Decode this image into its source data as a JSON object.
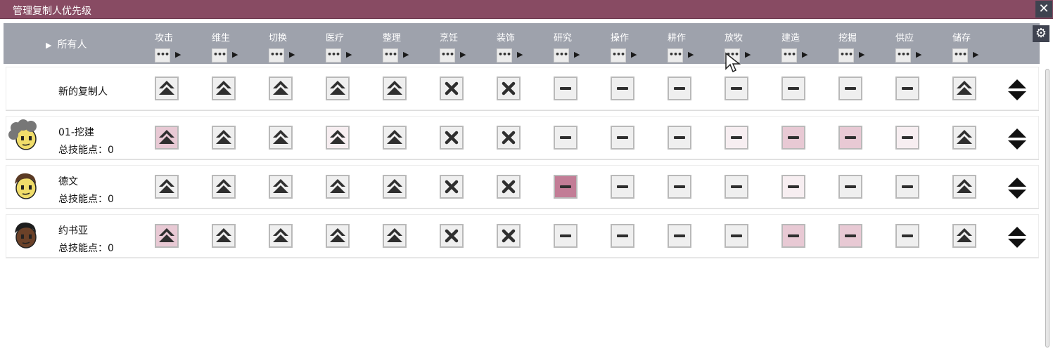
{
  "window": {
    "title": "管理复制人优先级",
    "close_glyph": "✕"
  },
  "header": {
    "owner_label": "所有人",
    "columns": [
      "攻击",
      "维生",
      "切换",
      "医疗",
      "整理",
      "烹饪",
      "装饰",
      "研究",
      "操作",
      "耕作",
      "放牧",
      "建造",
      "挖掘",
      "供应",
      "储存"
    ],
    "column_button_glyph": "•••"
  },
  "icons": {
    "collapse": "triangle-right-icon",
    "high": "double-chevron-up-icon",
    "disabled": "x-icon",
    "neutral": "minus-icon",
    "reorder": "up-down-arrows-icon",
    "settings": "gear-icon",
    "close": "close-icon"
  },
  "colors": {
    "titlebar": "#884b63",
    "header": "#9ea2ac",
    "tint_low": "#f7eef1",
    "tint_mid": "#e8c9d4",
    "tint_high": "#c27d96"
  },
  "rows": [
    {
      "name": "新的复制人",
      "skill_points": "",
      "avatar": "none",
      "cells": [
        {
          "icon": "up",
          "tint": 0
        },
        {
          "icon": "up",
          "tint": 0
        },
        {
          "icon": "up",
          "tint": 0
        },
        {
          "icon": "up",
          "tint": 0
        },
        {
          "icon": "up",
          "tint": 0
        },
        {
          "icon": "x",
          "tint": 0
        },
        {
          "icon": "x",
          "tint": 0
        },
        {
          "icon": "minus",
          "tint": 0
        },
        {
          "icon": "minus",
          "tint": 0
        },
        {
          "icon": "minus",
          "tint": 0
        },
        {
          "icon": "minus",
          "tint": 0
        },
        {
          "icon": "minus",
          "tint": 0
        },
        {
          "icon": "minus",
          "tint": 0
        },
        {
          "icon": "minus",
          "tint": 0
        },
        {
          "icon": "up",
          "tint": 0
        }
      ]
    },
    {
      "name": "01-挖建",
      "skill_points": "总技能点：0",
      "avatar": "gray-curly-hair",
      "cells": [
        {
          "icon": "up",
          "tint": 2
        },
        {
          "icon": "up",
          "tint": 0
        },
        {
          "icon": "up",
          "tint": 0
        },
        {
          "icon": "up",
          "tint": 1
        },
        {
          "icon": "up",
          "tint": 0
        },
        {
          "icon": "x",
          "tint": 0
        },
        {
          "icon": "x",
          "tint": 0
        },
        {
          "icon": "minus",
          "tint": 0
        },
        {
          "icon": "minus",
          "tint": 0
        },
        {
          "icon": "minus",
          "tint": 0
        },
        {
          "icon": "minus",
          "tint": 1
        },
        {
          "icon": "minus",
          "tint": 2
        },
        {
          "icon": "minus",
          "tint": 2
        },
        {
          "icon": "minus",
          "tint": 1
        },
        {
          "icon": "up",
          "tint": 0
        }
      ]
    },
    {
      "name": "德文",
      "skill_points": "总技能点：0",
      "avatar": "brown-hair",
      "cells": [
        {
          "icon": "up",
          "tint": 0
        },
        {
          "icon": "up",
          "tint": 0
        },
        {
          "icon": "up",
          "tint": 0
        },
        {
          "icon": "up",
          "tint": 0
        },
        {
          "icon": "up",
          "tint": 0
        },
        {
          "icon": "x",
          "tint": 0
        },
        {
          "icon": "x",
          "tint": 0
        },
        {
          "icon": "minus",
          "tint": 3
        },
        {
          "icon": "minus",
          "tint": 0
        },
        {
          "icon": "minus",
          "tint": 0
        },
        {
          "icon": "minus",
          "tint": 0
        },
        {
          "icon": "minus",
          "tint": 1
        },
        {
          "icon": "minus",
          "tint": 0
        },
        {
          "icon": "minus",
          "tint": 0
        },
        {
          "icon": "up",
          "tint": 0
        }
      ]
    },
    {
      "name": "约书亚",
      "skill_points": "总技能点：0",
      "avatar": "dark-skin-black-hair",
      "cells": [
        {
          "icon": "up",
          "tint": 2
        },
        {
          "icon": "up",
          "tint": 0
        },
        {
          "icon": "up",
          "tint": 0
        },
        {
          "icon": "up",
          "tint": 0
        },
        {
          "icon": "up",
          "tint": 0
        },
        {
          "icon": "x",
          "tint": 0
        },
        {
          "icon": "x",
          "tint": 0
        },
        {
          "icon": "minus",
          "tint": 0
        },
        {
          "icon": "minus",
          "tint": 0
        },
        {
          "icon": "minus",
          "tint": 0
        },
        {
          "icon": "minus",
          "tint": 0
        },
        {
          "icon": "minus",
          "tint": 2
        },
        {
          "icon": "minus",
          "tint": 2
        },
        {
          "icon": "minus",
          "tint": 0
        },
        {
          "icon": "up",
          "tint": 0
        }
      ]
    }
  ]
}
